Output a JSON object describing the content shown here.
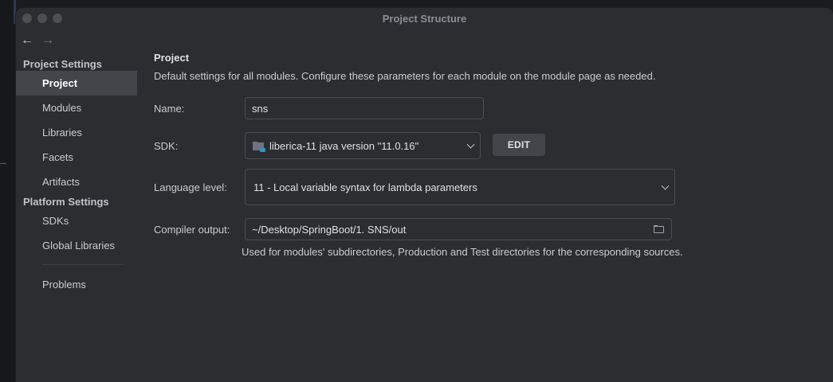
{
  "window": {
    "title": "Project Structure"
  },
  "nav": {
    "back": "←",
    "forward": "→"
  },
  "sidebar": {
    "project_settings_header": "Project Settings",
    "project_items": [
      {
        "label": "Project",
        "selected": true
      },
      {
        "label": "Modules",
        "selected": false
      },
      {
        "label": "Libraries",
        "selected": false
      },
      {
        "label": "Facets",
        "selected": false
      },
      {
        "label": "Artifacts",
        "selected": false
      }
    ],
    "platform_settings_header": "Platform Settings",
    "platform_items": [
      {
        "label": "SDKs"
      },
      {
        "label": "Global Libraries"
      }
    ],
    "problems_label": "Problems"
  },
  "pane": {
    "title": "Project",
    "description": "Default settings for all modules. Configure these parameters for each module on the module page as needed.",
    "name_label": "Name:",
    "name_value": "sns",
    "sdk_label": "SDK:",
    "sdk_value": "liberica-11 java version \"11.0.16\"",
    "sdk_icon": "folder-sdk-icon",
    "edit_button": "EDIT",
    "language_level_label": "Language level:",
    "language_level_value": "11 - Local variable syntax for lambda parameters",
    "compiler_output_label": "Compiler output:",
    "compiler_output_value": "~/Desktop/SpringBoot/1. SNS/out",
    "compiler_output_hint": "Used for modules' subdirectories, Production and Test directories for the corresponding sources."
  },
  "colors": {
    "window_bg": "#2b2d30",
    "selected_bg": "#43454a",
    "text": "#dfe1e5"
  }
}
